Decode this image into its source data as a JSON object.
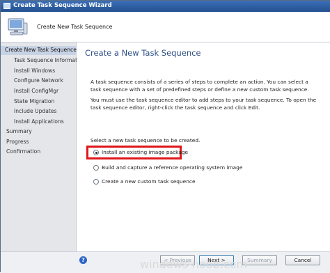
{
  "window": {
    "title": "Create Task Sequence Wizard"
  },
  "header": {
    "text": "Create New Task Sequence"
  },
  "sidebar": {
    "items": [
      {
        "label": "Create New Task Sequence",
        "selected": true,
        "level": 0
      },
      {
        "label": "Task Sequence Information",
        "selected": false,
        "level": 1
      },
      {
        "label": "Install Windows",
        "selected": false,
        "level": 1
      },
      {
        "label": "Configure Network",
        "selected": false,
        "level": 1
      },
      {
        "label": "Install ConfigMgr",
        "selected": false,
        "level": 1
      },
      {
        "label": "State Migration",
        "selected": false,
        "level": 1
      },
      {
        "label": "Include Updates",
        "selected": false,
        "level": 1
      },
      {
        "label": "Install Applications",
        "selected": false,
        "level": 1
      },
      {
        "label": "Summary",
        "selected": false,
        "level": 0
      },
      {
        "label": "Progress",
        "selected": false,
        "level": 0
      },
      {
        "label": "Confirmation",
        "selected": false,
        "level": 0
      }
    ]
  },
  "main": {
    "title": "Create a New Task Sequence",
    "para1": "A task sequence consists of a series of steps to complete an action. You can select a task sequence with a set of predefined steps or define a new custom task sequence.",
    "para2": "You must use the task sequence editor to add steps to your task sequence. To open the task sequence editor, right-click the task sequence and click Edit.",
    "prompt": "Select a new task sequence to be created.",
    "options": [
      {
        "label": "Install an existing image package",
        "checked": true
      },
      {
        "label": "Build and capture a reference operating system image",
        "checked": false
      },
      {
        "label": "Create a new custom task sequence",
        "checked": false
      }
    ]
  },
  "footer": {
    "help": "?",
    "buttons": {
      "previous": "< Previous",
      "next": "Next >",
      "summary": "Summary",
      "cancel": "Cancel"
    }
  },
  "watermark": "windows-noob.com",
  "colors": {
    "title_bar": "#23518f",
    "page_title": "#2e4f86",
    "highlight_border": "#e0161a",
    "sidebar_bg": "#e4e6ea",
    "sidebar_selected": "#c7d2e4"
  }
}
